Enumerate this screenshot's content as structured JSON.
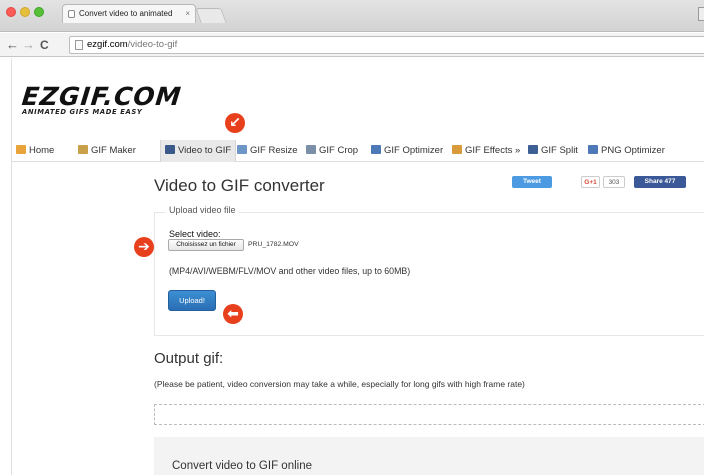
{
  "browser": {
    "tab_title": "Convert video to animated",
    "tab_close": "×",
    "back": "←",
    "forward": "→",
    "reload": "C",
    "url_domain": "ezgif.com",
    "url_path": "/video-to-gif"
  },
  "site": {
    "logo": "EZGIF.COM",
    "tagline": "ANIMATED GIFS MADE EASY"
  },
  "nav": [
    {
      "label": "Home",
      "icon": "home-icon"
    },
    {
      "label": "GIF Maker",
      "icon": "gif-maker-icon"
    },
    {
      "label": "Video to GIF",
      "icon": "film-icon",
      "active": true
    },
    {
      "label": "GIF Resize",
      "icon": "resize-icon"
    },
    {
      "label": "GIF Crop",
      "icon": "crop-icon"
    },
    {
      "label": "GIF Optimizer",
      "icon": "optimizer-icon"
    },
    {
      "label": "GIF Effects »",
      "icon": "effects-icon"
    },
    {
      "label": "GIF Split",
      "icon": "split-icon"
    },
    {
      "label": "PNG Optimizer",
      "icon": "png-optimizer-icon"
    }
  ],
  "page": {
    "title": "Video to GIF converter",
    "tweet": "Tweet",
    "gplus": "G+1",
    "gplus_count": "303",
    "fb_share": "Share 477",
    "upload_legend": "Upload video file",
    "select_label": "Select video:",
    "choose_file": "Choisissez un fichier",
    "file_name": "PRU_1782.MOV",
    "formats_hint": "(MP4/AVI/WEBM/FLV/MOV and other video files, up to 60MB)",
    "upload_button": "Upload!",
    "output_title": "Output gif:",
    "patience_note": "(Please be patient, video conversion may take a while, especially for long gifs with high frame rate)",
    "convert_heading": "Convert video to GIF online"
  },
  "annotations": {
    "arrow_glyph_down_left": "↙",
    "arrow_glyph_right": "➔",
    "arrow_glyph_left": "⬅"
  },
  "colors": {
    "upload_button": "#2a6eb4",
    "annotation_arrow": "#e8401c",
    "tweet": "#4c9be2",
    "facebook": "#3b5998"
  }
}
